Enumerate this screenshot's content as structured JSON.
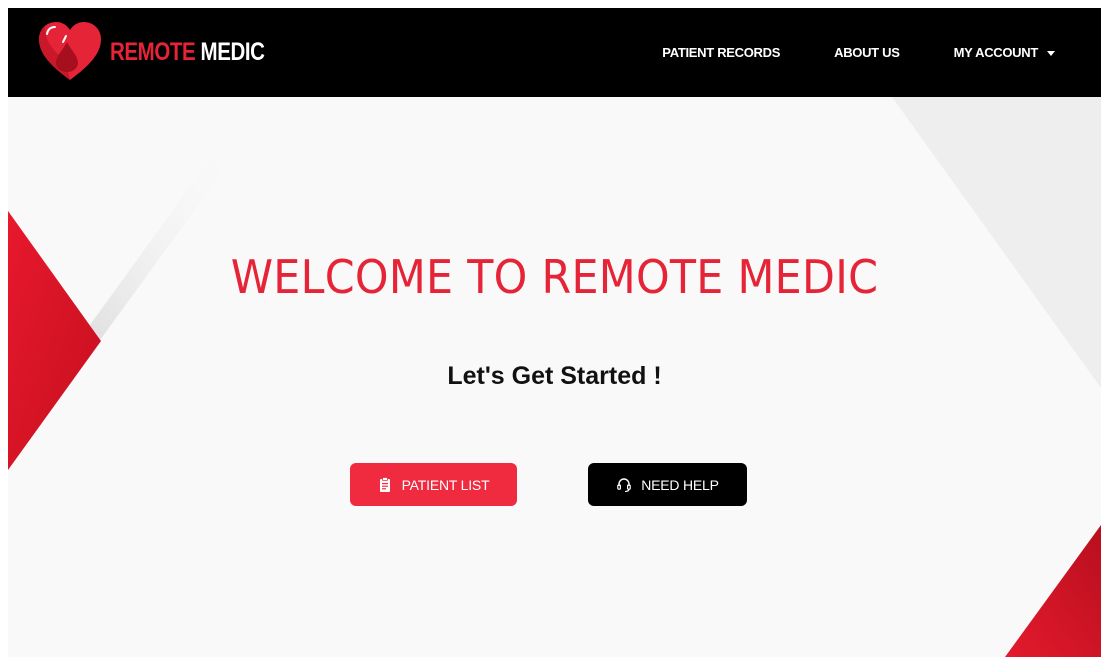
{
  "brand": {
    "name_part1": "REMOTE",
    "name_part2": "MEDIC",
    "logo_icon": "heart-blood-drop-icon"
  },
  "nav": {
    "patient_records": "PATIENT RECORDS",
    "about_us": "ABOUT US",
    "my_account": "MY ACCOUNT",
    "account_icon": "caret-down-icon"
  },
  "hero": {
    "title": "WELCOME TO REMOTE MEDIC",
    "subtitle": "Let's Get Started !"
  },
  "buttons": {
    "patient_list": "PATIENT LIST",
    "patient_list_icon": "clipboard-icon",
    "need_help": "NEED HELP",
    "need_help_icon": "headset-icon"
  },
  "colors": {
    "accent_red": "#e52437",
    "button_red": "#f02b3f",
    "navbar_black": "#000000",
    "background": "#f9f9f9"
  }
}
